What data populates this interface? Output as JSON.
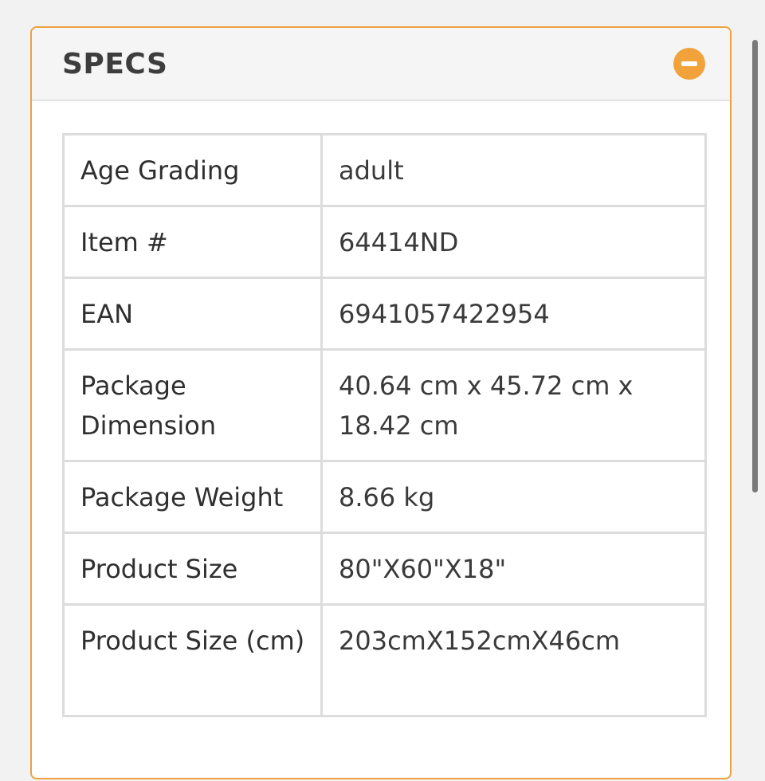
{
  "panel": {
    "title": "SPECS",
    "collapse_icon": "minus-circle-icon",
    "accent_color": "#f2a23a"
  },
  "specs": [
    {
      "label": "Age Grading",
      "value": "adult"
    },
    {
      "label": "Item #",
      "value": "64414ND"
    },
    {
      "label": "EAN",
      "value": "6941057422954"
    },
    {
      "label": "Package Dimension",
      "value": "40.64 cm x 45.72 cm x 18.42 cm"
    },
    {
      "label": "Package Weight",
      "value": "8.66 kg"
    },
    {
      "label": "Product Size",
      "value": "80\"X60\"X18\""
    },
    {
      "label": "Product Size (cm)",
      "value": "203cmX152cmX46cm"
    }
  ]
}
